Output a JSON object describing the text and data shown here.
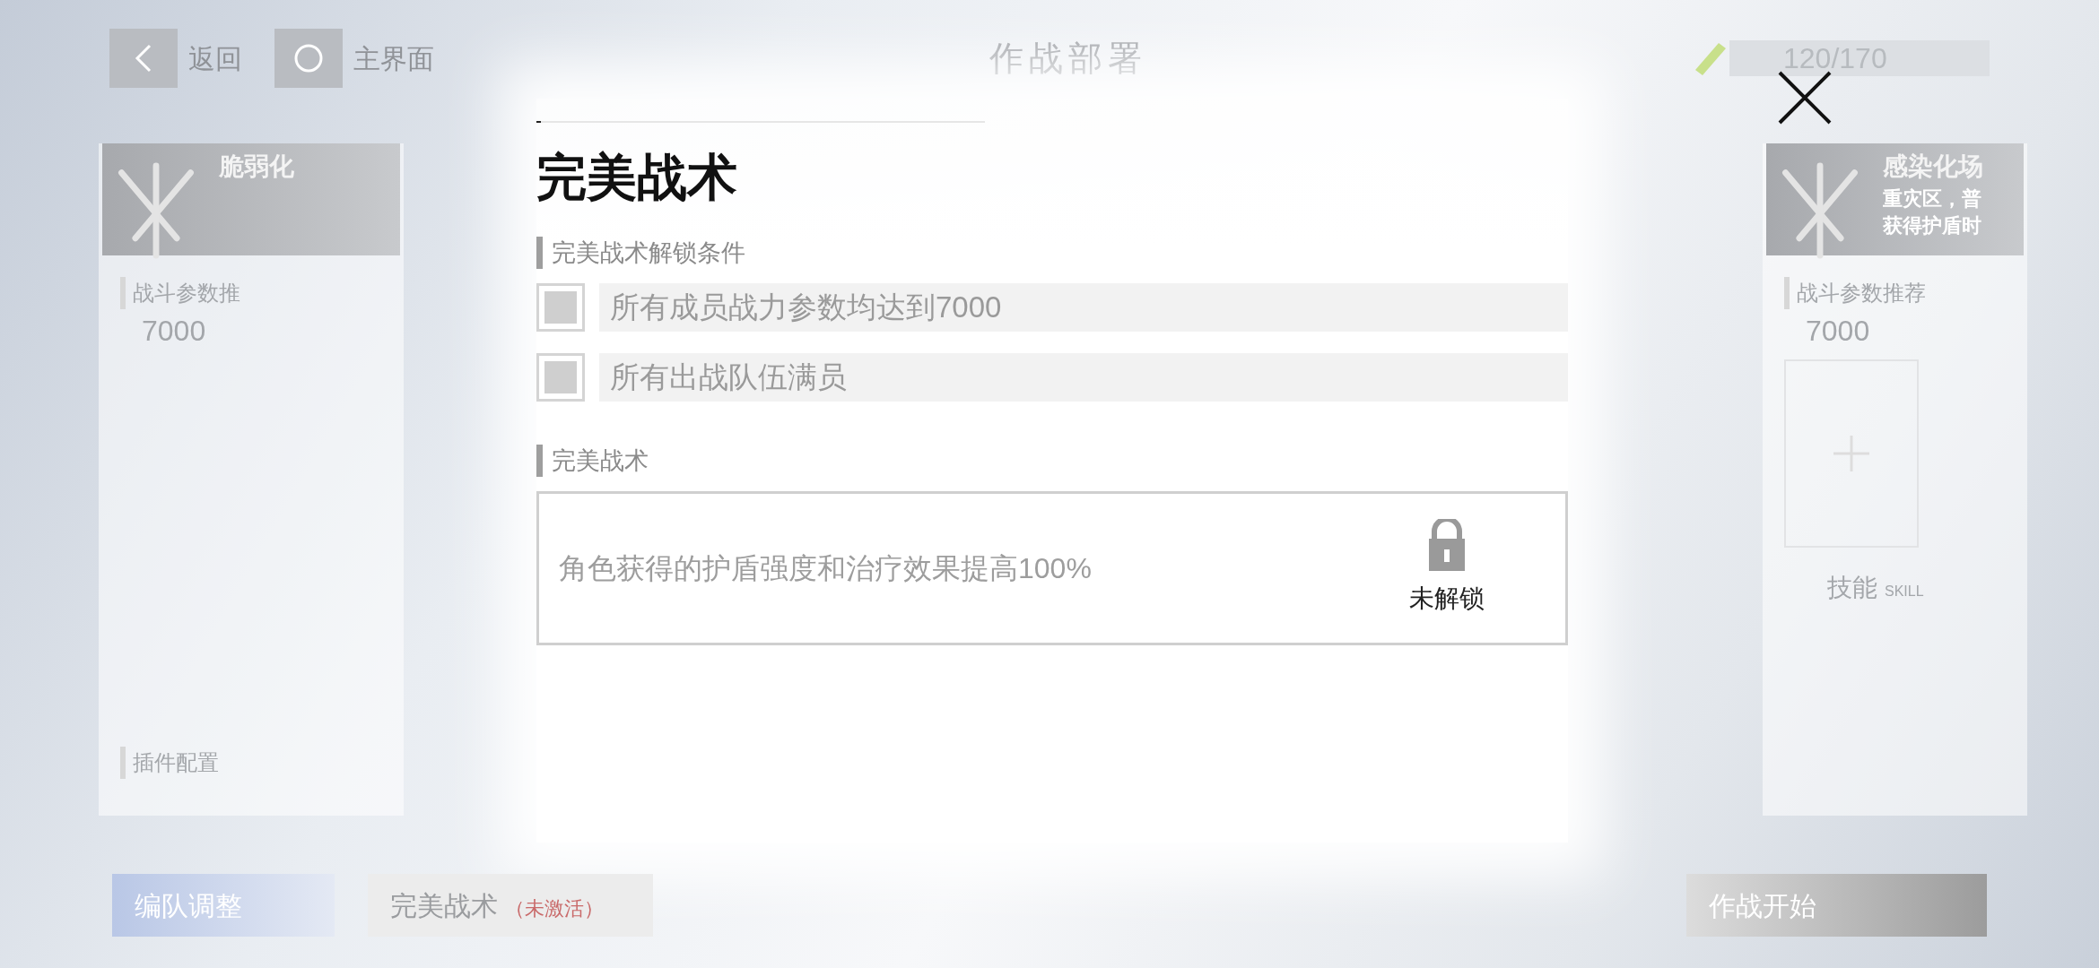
{
  "top_bar": {
    "back": "返回",
    "home": "主界面",
    "title": "作战部署",
    "energy": "120/170"
  },
  "left_card": {
    "title": "脆弱化",
    "rec_label": "战斗参数推",
    "rec_value": "7000",
    "plugin_label": "插件配置"
  },
  "right_card": {
    "title": "感染化场",
    "lines": [
      "重灾区，普",
      "获得护盾时"
    ],
    "rec_label": "战斗参数推荐",
    "rec_value": "7000",
    "skill": "技能",
    "skill_en": "SKILL"
  },
  "modal": {
    "title": "完美战术",
    "conditions_label": "完美战术解锁条件",
    "conditions": [
      {
        "text": "所有成员战力参数均达到7000",
        "checked": false
      },
      {
        "text": "所有出战队伍满员",
        "checked": false
      }
    ],
    "effect_label": "完美战术",
    "effect": {
      "text": "角色获得的护盾强度和治疗效果提高100%",
      "locked": true,
      "lock_label": "未解锁"
    }
  },
  "bottom_bar": [
    {
      "kind": "team",
      "label": "编队调整"
    },
    {
      "kind": "tactics",
      "label": "完美战术",
      "status": "（未激活）"
    },
    {
      "kind": "start",
      "label": "作战开始"
    }
  ]
}
